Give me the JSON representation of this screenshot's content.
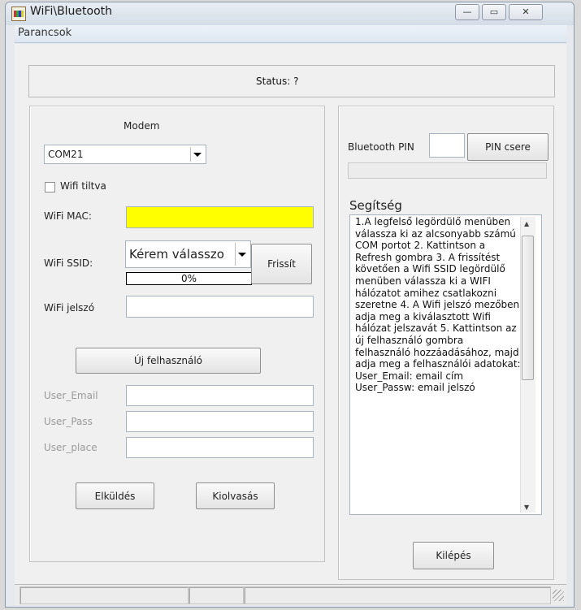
{
  "window": {
    "title": "WiFi\\Bluetooth",
    "controls": {
      "minimize": "—",
      "maximize": "▭",
      "close": "✕"
    }
  },
  "menubar": {
    "items": [
      {
        "label": "Parancsok"
      }
    ]
  },
  "status": {
    "text": "Status: ?"
  },
  "modem_group": {
    "title": "Modem",
    "com_select": {
      "value": "COM21"
    },
    "wifi_disabled": {
      "label": "Wifi tiltva",
      "checked": false
    },
    "wifi_mac": {
      "label": "WiFi MAC:",
      "value": "",
      "highlight": "#ffff00"
    },
    "wifi_ssid": {
      "label": "WiFi SSID:",
      "value": "Kérem válasszo"
    },
    "refresh_button": "Frissít",
    "progress": {
      "text": "0%",
      "percent": 0
    },
    "wifi_password": {
      "label": "WiFi jelszó",
      "value": ""
    },
    "new_user_button": "Új felhasználó",
    "user_email": {
      "label": "User_Email",
      "value": ""
    },
    "user_pass": {
      "label": "User_Pass",
      "value": ""
    },
    "user_place": {
      "label": "User_place",
      "value": ""
    },
    "send_button": "Elküldés",
    "read_button": "Kiolvasás"
  },
  "bluetooth": {
    "pin_label": "Bluetooth PIN",
    "pin_value": "",
    "pin_change_button": "PIN csere",
    "status_value": ""
  },
  "help": {
    "title": "Segítség",
    "text": "1.A legfelső legördülő menüben válassza ki az alcsonyabb számú COM portot 2. Kattintson a Refresh gombra 3. A frissítést követően a Wifi SSID legördülő menüben válassza ki a WIFI hálózatot amihez csatlakozni szeretne 4. A Wifi jelszó mezőben adja meg a kiválasztott Wifi hálózat jelszavát 5. Kattintson az új felhasználó gombra felhasználó hozzáadásához, majd adja meg a felhasználói adatokat: User_Email: email cím User_Passw: email jelszó"
  },
  "exit_button": "Kilépés"
}
